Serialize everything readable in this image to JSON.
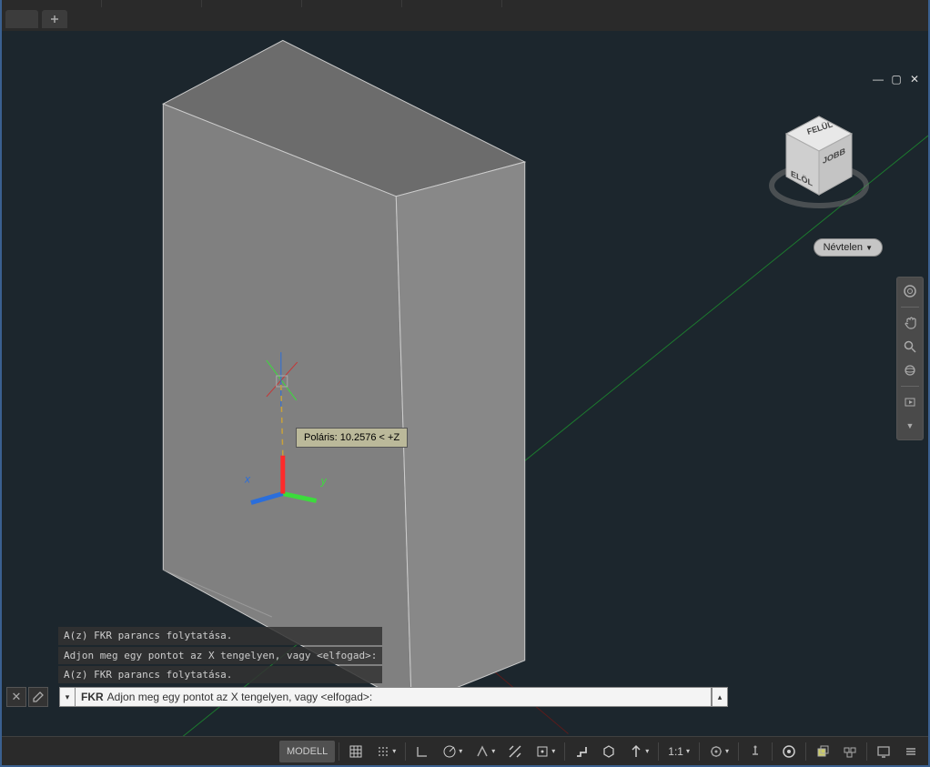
{
  "app": {
    "unnamed_label": "Névtelen"
  },
  "viewcube": {
    "top": "FELÜL",
    "left": "ELÖL",
    "right": "JOBB"
  },
  "tooltip": {
    "text": "Poláris: 10.2576 < +Z"
  },
  "command_history": [
    "A(z) FKR parancs folytatása.",
    "Adjon meg egy pontot az X tengelyen, vagy <elfogad>:",
    "A(z) FKR parancs folytatása."
  ],
  "command_line": {
    "keyword": "FKR",
    "prompt": "Adjon meg egy pontot az X tengelyen, vagy <elfogad>:"
  },
  "statusbar": {
    "model": "MODELL",
    "scale": "1:1"
  }
}
